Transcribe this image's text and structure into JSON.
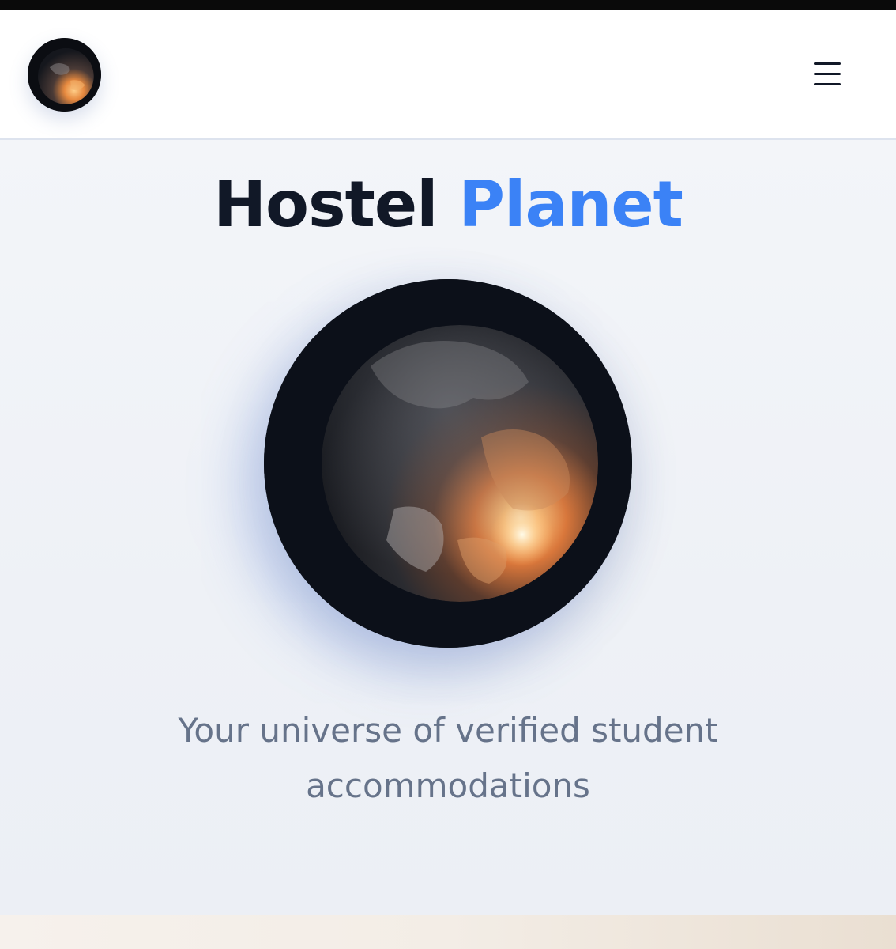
{
  "header": {
    "logo_icon": "planet-logo-icon",
    "menu_icon": "hamburger-menu-icon"
  },
  "hero": {
    "title_part1": "Hostel",
    "title_part2": "Planet",
    "tagline_line1": "Your universe of verified student",
    "tagline_line2": "accommodations",
    "image_icon": "planet-eclipse-illustration"
  },
  "colors": {
    "title_dark": "#111827",
    "accent": "#3b82f6",
    "tagline": "#66738a",
    "background": "#eef1f6",
    "header_bg": "#ffffff"
  }
}
